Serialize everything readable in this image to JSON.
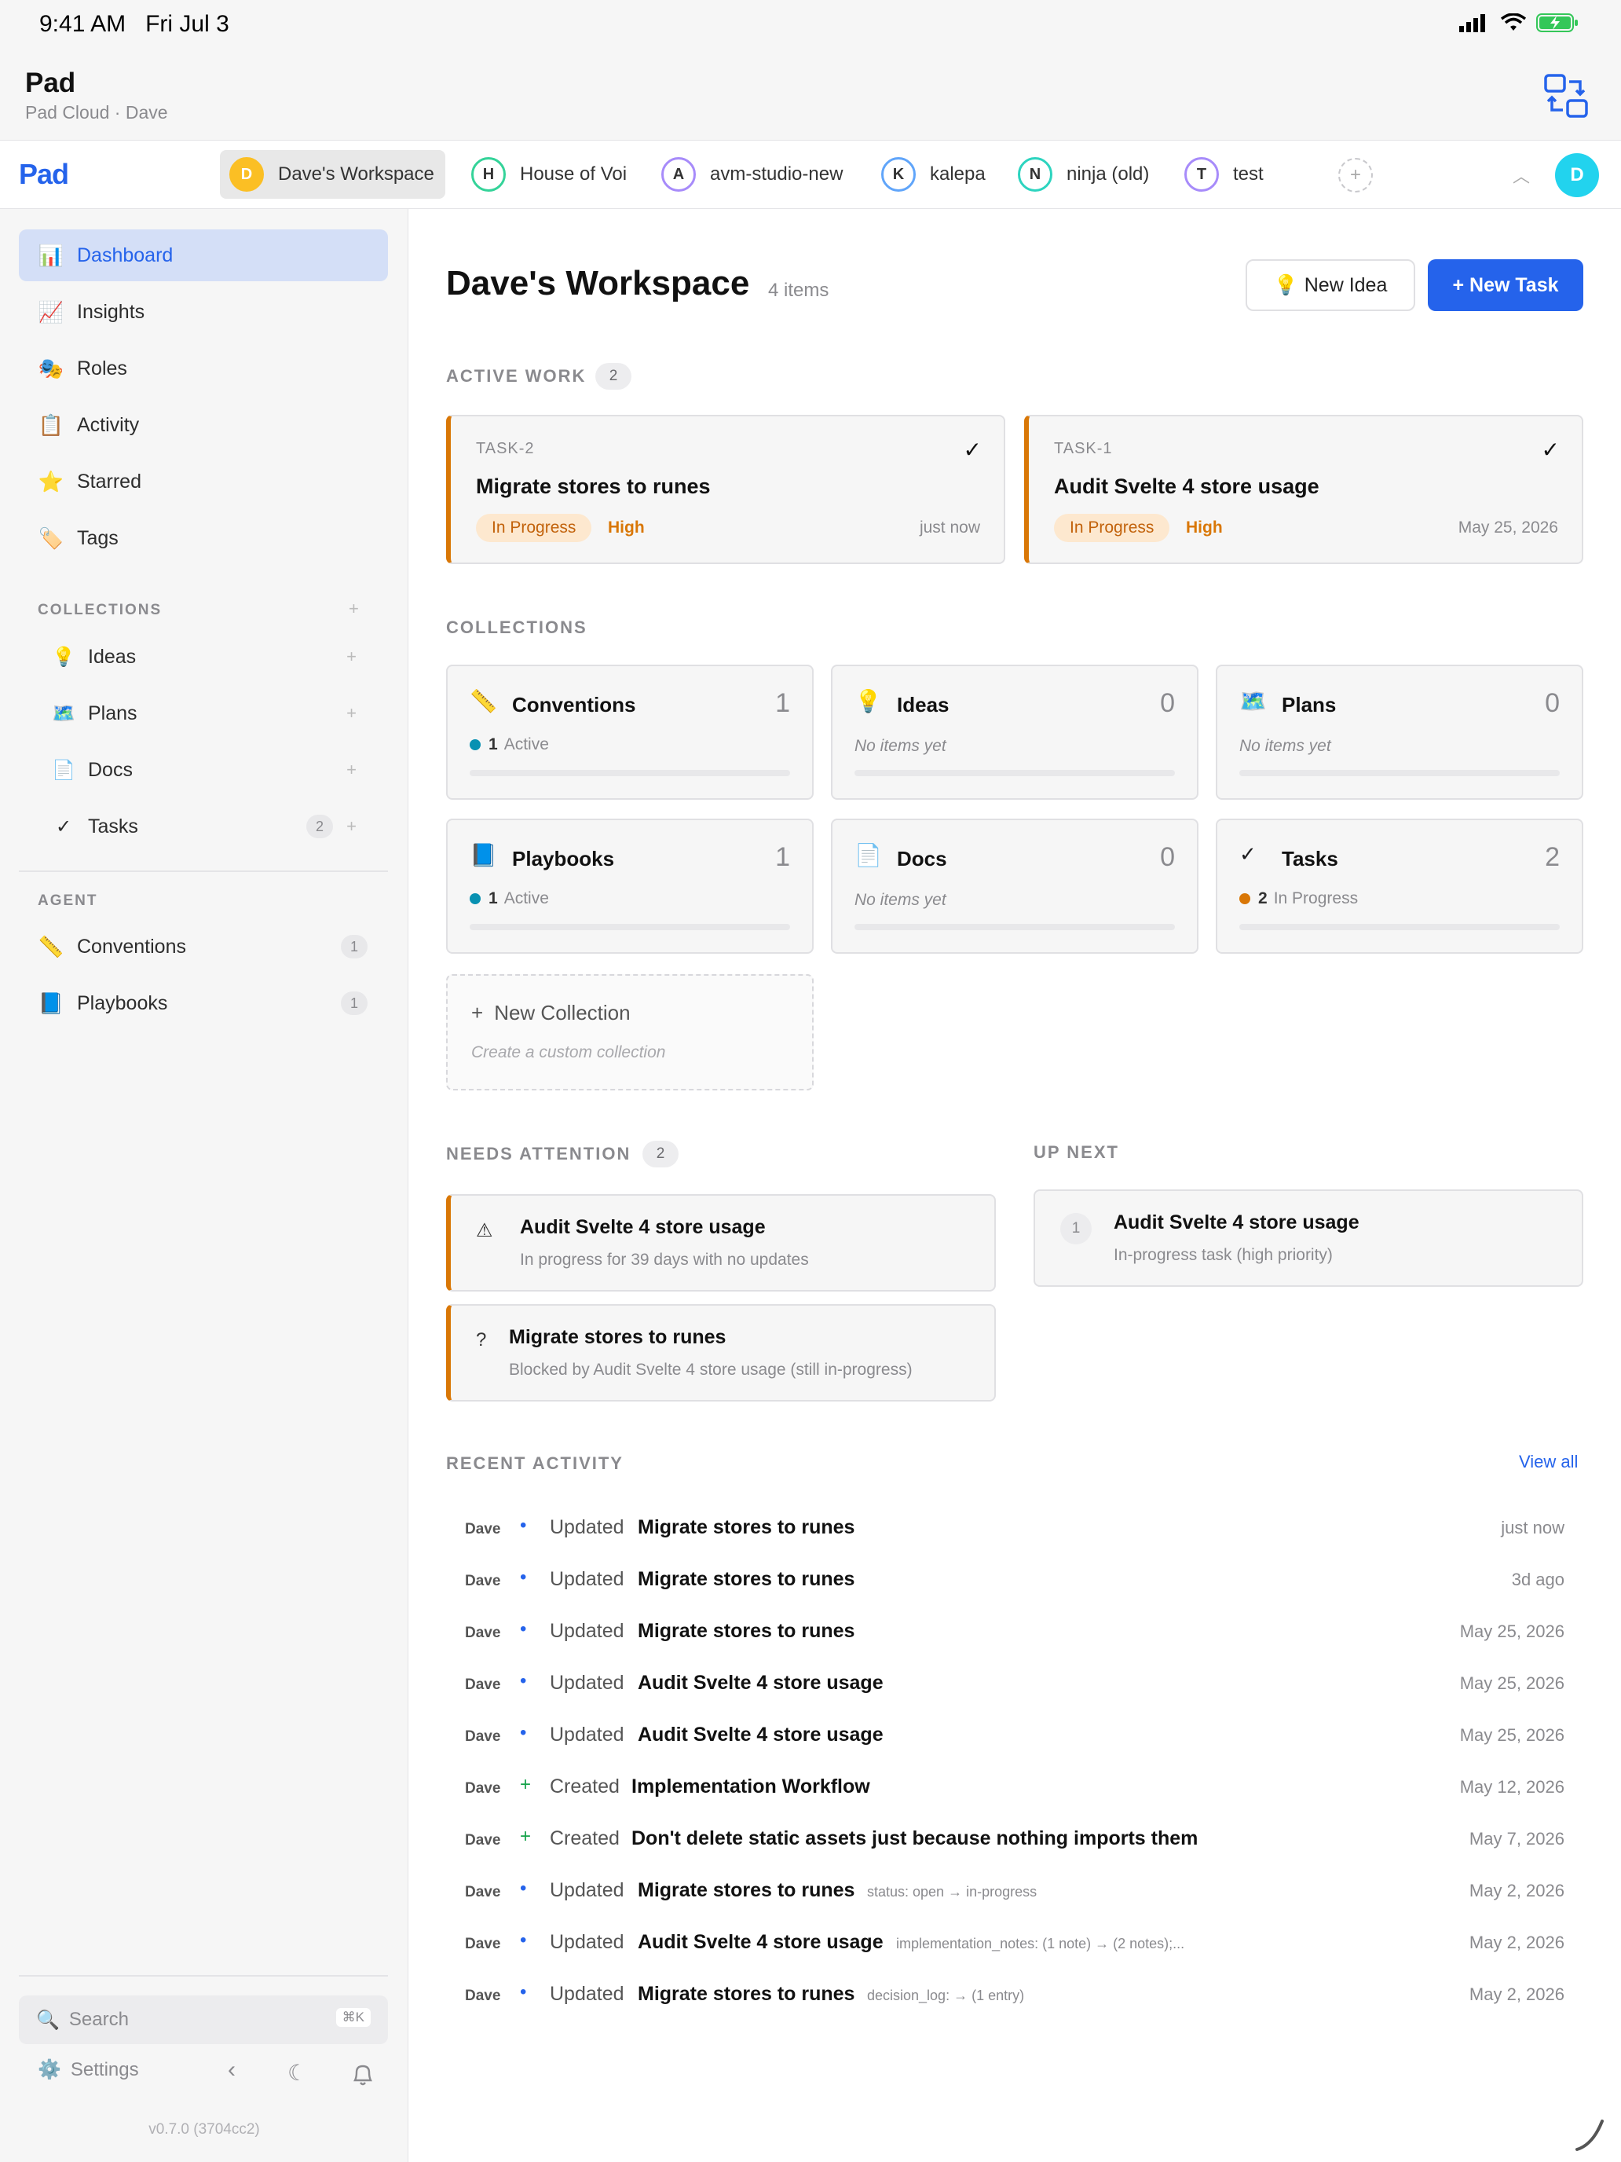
{
  "status_bar": {
    "time": "9:41 AM",
    "date": "Fri Jul 3"
  },
  "app": {
    "title": "Pad",
    "subtitle": "Pad Cloud · Dave",
    "logo": "Pad"
  },
  "workspaces": [
    {
      "initial": "D",
      "name": "Dave's Workspace",
      "color": "#fbbf24",
      "active": true
    },
    {
      "initial": "H",
      "name": "House of Voi",
      "color": "#34d399"
    },
    {
      "initial": "A",
      "name": "avm-studio-new",
      "color": "#a78bfa"
    },
    {
      "initial": "K",
      "name": "kalepa",
      "color": "#60a5fa"
    },
    {
      "initial": "N",
      "name": "ninja (old)",
      "color": "#2dd4bf"
    },
    {
      "initial": "T",
      "name": "test",
      "color": "#a78bfa"
    }
  ],
  "add_workspace": "+",
  "user_avatar": "D",
  "sidebar": {
    "nav": [
      {
        "label": "Dashboard",
        "icon": "bar-chart-icon"
      },
      {
        "label": "Insights",
        "icon": "trend-chart-icon"
      },
      {
        "label": "Roles",
        "icon": "masks-icon"
      },
      {
        "label": "Activity",
        "icon": "clipboard-icon"
      },
      {
        "label": "Starred",
        "icon": "star-icon"
      },
      {
        "label": "Tags",
        "icon": "tag-icon"
      }
    ],
    "collections_heading": "COLLECTIONS",
    "collections": [
      {
        "label": "Ideas",
        "icon": "lightbulb-icon"
      },
      {
        "label": "Plans",
        "icon": "map-icon"
      },
      {
        "label": "Docs",
        "icon": "document-icon"
      },
      {
        "label": "Tasks",
        "icon": "checkmark-icon",
        "count": "2"
      }
    ],
    "agent_heading": "AGENT",
    "agent": [
      {
        "label": "Conventions",
        "icon": "ruler-icon",
        "count": "1"
      },
      {
        "label": "Playbooks",
        "icon": "book-icon",
        "count": "1"
      }
    ],
    "search_placeholder": "Search",
    "search_shortcut": "⌘K",
    "settings_label": "Settings",
    "version": "v0.7.0 (3704cc2)"
  },
  "main": {
    "title": "Dave's Workspace",
    "item_count": "4 items",
    "new_idea": "New Idea",
    "new_task": "+ New Task",
    "active_work": {
      "heading": "ACTIVE WORK",
      "count": "2",
      "tasks": [
        {
          "id": "TASK-2",
          "title": "Migrate stores to runes",
          "status": "In Progress",
          "priority": "High",
          "when": "just now"
        },
        {
          "id": "TASK-1",
          "title": "Audit Svelte 4 store usage",
          "status": "In Progress",
          "priority": "High",
          "when": "May 25, 2026"
        }
      ]
    },
    "collections": {
      "heading": "COLLECTIONS",
      "cards": [
        {
          "name": "Conventions",
          "icon": "ruler-icon",
          "count": "1",
          "stat_num": "1",
          "stat_label": "Active",
          "dot": "#0891b2"
        },
        {
          "name": "Ideas",
          "icon": "lightbulb-icon",
          "count": "0",
          "empty": "No items yet"
        },
        {
          "name": "Plans",
          "icon": "map-icon",
          "count": "0",
          "empty": "No items yet"
        },
        {
          "name": "Playbooks",
          "icon": "book-icon",
          "count": "1",
          "stat_num": "1",
          "stat_label": "Active",
          "dot": "#0891b2"
        },
        {
          "name": "Docs",
          "icon": "document-icon",
          "count": "0",
          "empty": "No items yet"
        },
        {
          "name": "Tasks",
          "icon": "checkmark-icon",
          "count": "2",
          "stat_num": "2",
          "stat_label": "In Progress",
          "dot": "#d97706"
        }
      ],
      "new_title": "New Collection",
      "new_subtitle": "Create a custom collection"
    },
    "needs_attention": {
      "heading": "NEEDS ATTENTION",
      "count": "2",
      "items": [
        {
          "icon": "⚠",
          "title": "Audit Svelte 4 store usage",
          "subtitle": "In progress for 39 days with no updates"
        },
        {
          "icon": "?",
          "title": "Migrate stores to runes",
          "subtitle": "Blocked by Audit Svelte 4 store usage (still in-progress)"
        }
      ]
    },
    "up_next": {
      "heading": "UP NEXT",
      "items": [
        {
          "num": "1",
          "title": "Audit Svelte 4 store usage",
          "subtitle": "In-progress task (high priority)"
        }
      ]
    },
    "recent_activity": {
      "heading": "RECENT ACTIVITY",
      "view_all": "View all",
      "rows": [
        {
          "who": "Dave",
          "mark": "•",
          "verb": "Updated",
          "obj": "Migrate stores to runes",
          "meta": "",
          "when": "just now"
        },
        {
          "who": "Dave",
          "mark": "•",
          "verb": "Updated",
          "obj": "Migrate stores to runes",
          "meta": "",
          "when": "3d ago"
        },
        {
          "who": "Dave",
          "mark": "•",
          "verb": "Updated",
          "obj": "Migrate stores to runes",
          "meta": "",
          "when": "May 25, 2026"
        },
        {
          "who": "Dave",
          "mark": "•",
          "verb": "Updated",
          "obj": "Audit Svelte 4 store usage",
          "meta": "",
          "when": "May 25, 2026"
        },
        {
          "who": "Dave",
          "mark": "•",
          "verb": "Updated",
          "obj": "Audit Svelte 4 store usage",
          "meta": "",
          "when": "May 25, 2026"
        },
        {
          "who": "Dave",
          "mark": "+",
          "verb": "Created",
          "obj": "Implementation Workflow",
          "meta": "",
          "when": "May 12, 2026"
        },
        {
          "who": "Dave",
          "mark": "+",
          "verb": "Created",
          "obj": "Don't delete static assets just because nothing imports them",
          "meta": "",
          "when": "May 7, 2026"
        },
        {
          "who": "Dave",
          "mark": "•",
          "verb": "Updated",
          "obj": "Migrate stores to runes",
          "meta": "status: open → in-progress",
          "when": "May 2, 2026"
        },
        {
          "who": "Dave",
          "mark": "•",
          "verb": "Updated",
          "obj": "Audit Svelte 4 store usage",
          "meta": "implementation_notes: (1 note) → (2 notes);...",
          "when": "May 2, 2026"
        },
        {
          "who": "Dave",
          "mark": "•",
          "verb": "Updated",
          "obj": "Migrate stores to runes",
          "meta": "decision_log: → (1 entry)",
          "when": "May 2, 2026"
        }
      ]
    }
  },
  "colors": {
    "accent": "#2563eb",
    "warning": "#d97706",
    "active_nav_bg": "#d4dff7"
  }
}
